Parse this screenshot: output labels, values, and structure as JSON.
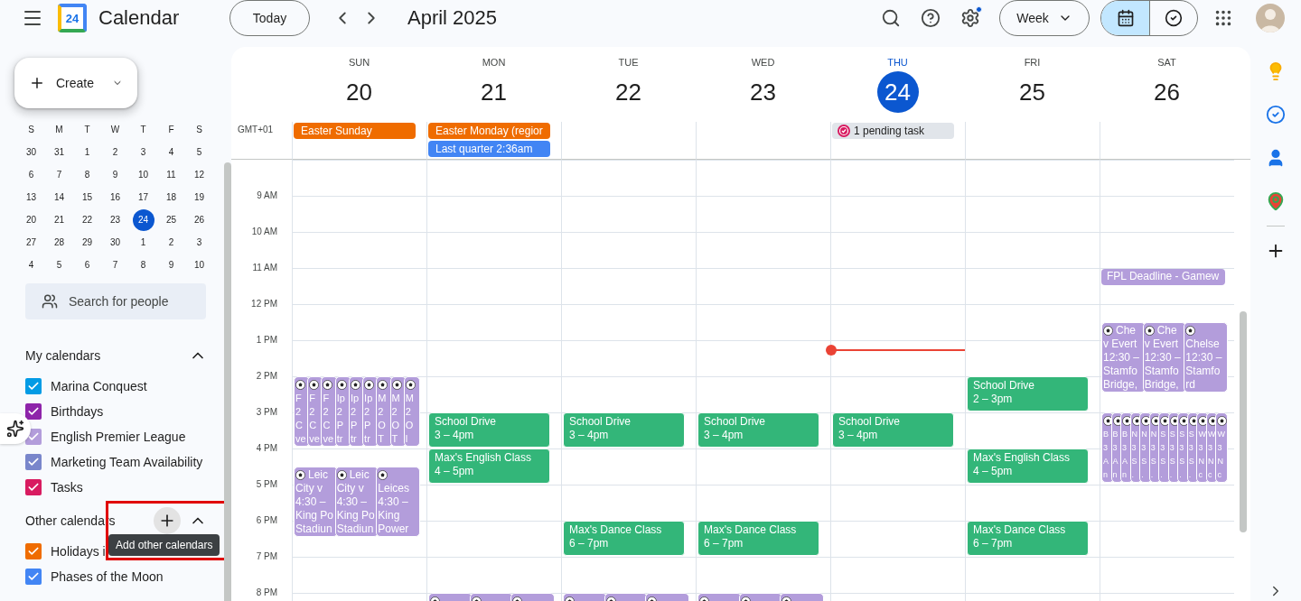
{
  "app": {
    "logo_text": "24",
    "name": "Calendar"
  },
  "toolbar": {
    "today": "Today",
    "title": "April 2025",
    "settings_badge": true,
    "view": "Week",
    "view_toggle": [
      {
        "kind": "calendar",
        "selected": true
      },
      {
        "kind": "tasks",
        "selected": false
      }
    ]
  },
  "sidebar": {
    "create": "Create",
    "mini_calendar": {
      "weekdays": [
        "S",
        "M",
        "T",
        "W",
        "T",
        "F",
        "S"
      ],
      "weeks": [
        [
          {
            "label": "30",
            "selected": false
          },
          {
            "label": "31",
            "selected": false
          },
          {
            "label": "1",
            "selected": false
          },
          {
            "label": "2",
            "selected": false
          },
          {
            "label": "3",
            "selected": false
          },
          {
            "label": "4",
            "selected": false
          },
          {
            "label": "5",
            "selected": false
          }
        ],
        [
          {
            "label": "6",
            "selected": false
          },
          {
            "label": "7",
            "selected": false
          },
          {
            "label": "8",
            "selected": false
          },
          {
            "label": "9",
            "selected": false
          },
          {
            "label": "10",
            "selected": false
          },
          {
            "label": "11",
            "selected": false
          },
          {
            "label": "12",
            "selected": false
          }
        ],
        [
          {
            "label": "13",
            "selected": false
          },
          {
            "label": "14",
            "selected": false
          },
          {
            "label": "15",
            "selected": false
          },
          {
            "label": "16",
            "selected": false
          },
          {
            "label": "17",
            "selected": false
          },
          {
            "label": "18",
            "selected": false
          },
          {
            "label": "19",
            "selected": false
          }
        ],
        [
          {
            "label": "20",
            "selected": false
          },
          {
            "label": "21",
            "selected": false
          },
          {
            "label": "22",
            "selected": false
          },
          {
            "label": "23",
            "selected": false
          },
          {
            "label": "24",
            "selected": true
          },
          {
            "label": "25",
            "selected": false
          },
          {
            "label": "26",
            "selected": false
          }
        ],
        [
          {
            "label": "27",
            "selected": false
          },
          {
            "label": "28",
            "selected": false
          },
          {
            "label": "29",
            "selected": false
          },
          {
            "label": "30",
            "selected": false
          },
          {
            "label": "1",
            "selected": false
          },
          {
            "label": "2",
            "selected": false
          },
          {
            "label": "3",
            "selected": false
          }
        ],
        [
          {
            "label": "4",
            "selected": false
          },
          {
            "label": "5",
            "selected": false
          },
          {
            "label": "6",
            "selected": false
          },
          {
            "label": "7",
            "selected": false
          },
          {
            "label": "8",
            "selected": false
          },
          {
            "label": "9",
            "selected": false
          },
          {
            "label": "10",
            "selected": false
          }
        ]
      ]
    },
    "search_people": "Search for people",
    "my_calendars": {
      "title": "My calendars",
      "expanded": true,
      "items": [
        {
          "label": "Marina Conquest",
          "checked": true,
          "color": "#039be5"
        },
        {
          "label": "Birthdays",
          "checked": true,
          "color": "#8e24aa"
        },
        {
          "label": "English Premier League",
          "checked": true,
          "color": "#b39ddb"
        },
        {
          "label": "Marketing Team Availability",
          "checked": true,
          "color": "#7986cb"
        },
        {
          "label": "Tasks",
          "checked": true,
          "color": "#d81b60"
        }
      ]
    },
    "other_calendars": {
      "title": "Other calendars",
      "expanded": true,
      "add_tooltip": "Add other calendars",
      "items": [
        {
          "label": "Holidays i",
          "checked": true,
          "color": "#ef6c00"
        },
        {
          "label": "Phases of the Moon",
          "checked": true,
          "color": "#4285f4"
        }
      ]
    }
  },
  "week": {
    "timezone": "GMT+01",
    "hours": [
      "9 AM",
      "10 AM",
      "11 AM",
      "12 PM",
      "1 PM",
      "2 PM",
      "3 PM",
      "4 PM",
      "5 PM",
      "6 PM",
      "7 PM",
      "8 PM"
    ],
    "days": [
      {
        "weekday": "SUN",
        "date": "20",
        "selected": false,
        "all_day": [
          {
            "kind": "event",
            "title": "Easter Sunday",
            "color": "#ef6c00"
          }
        ],
        "events": [
          {
            "kind": "group",
            "color": "#b39ddb",
            "cards": [
              {
                "lines": [
                  "F",
                  "2",
                  "C",
                  "ve"
                ]
              },
              {
                "lines": [
                  "F",
                  "2",
                  "C",
                  "ve"
                ]
              },
              {
                "lines": [
                  "F",
                  "2",
                  "C",
                  "ve"
                ]
              },
              {
                "lines": [
                  "Ip",
                  "2",
                  "P",
                  "tr"
                ]
              },
              {
                "lines": [
                  "Ip",
                  "2",
                  "P",
                  "tr"
                ]
              },
              {
                "lines": [
                  "Ip",
                  "2",
                  "P",
                  "tr"
                ]
              },
              {
                "lines": [
                  "M",
                  "2",
                  "O",
                  "T"
                ]
              },
              {
                "lines": [
                  "M",
                  "2",
                  "O",
                  "T"
                ]
              },
              {
                "lines": [
                  "M",
                  "2",
                  "O",
                  "l"
                ]
              }
            ]
          },
          {
            "kind": "group",
            "color": "#b39ddb",
            "cards": [
              {
                "title": "Leic",
                "lines": [
                  "City v",
                  "4:30 –",
                  "King Po",
                  "Stadiun"
                ]
              },
              {
                "title": "Leic",
                "lines": [
                  "City v",
                  "4:30 –",
                  "King Po",
                  "Stadiun"
                ]
              },
              {
                "lines": [
                  "Leices",
                  "4:30 –",
                  "King",
                  "Power"
                ]
              }
            ]
          }
        ]
      },
      {
        "weekday": "MON",
        "date": "21",
        "selected": false,
        "all_day": [
          {
            "kind": "event",
            "title": "Easter Monday (regior",
            "color": "#ef6c00"
          },
          {
            "kind": "event",
            "title": "Last quarter 2:36am",
            "color": "#4285f4"
          }
        ],
        "events": [
          {
            "kind": "event",
            "title": "School Drive",
            "time": "3 – 4pm",
            "color": "#33b679"
          },
          {
            "kind": "event",
            "title": "Max's English Class",
            "time": "4 – 5pm",
            "color": "#33b679"
          },
          {
            "kind": "group",
            "color": "#b39ddb",
            "cards": [
              {
                "kind": "icon_only"
              },
              {
                "kind": "icon_only"
              },
              {
                "kind": "icon_only"
              }
            ]
          }
        ]
      },
      {
        "weekday": "TUE",
        "date": "22",
        "selected": false,
        "events": [
          {
            "kind": "event",
            "title": "School Drive",
            "time": "3 – 4pm",
            "color": "#33b679"
          },
          {
            "kind": "event",
            "title": "Max's Dance Class",
            "time": "6 – 7pm",
            "color": "#33b679"
          },
          {
            "kind": "group",
            "color": "#b39ddb",
            "cards": [
              {
                "kind": "icon_only"
              },
              {
                "kind": "icon_only"
              },
              {
                "kind": "icon_only"
              }
            ]
          }
        ]
      },
      {
        "weekday": "WED",
        "date": "23",
        "selected": false,
        "events": [
          {
            "kind": "event",
            "title": "School Drive",
            "time": "3 – 4pm",
            "color": "#33b679"
          },
          {
            "kind": "event",
            "title": "Max's Dance Class",
            "time": "6 – 7pm",
            "color": "#33b679"
          },
          {
            "kind": "group",
            "color": "#b39ddb",
            "cards": [
              {
                "kind": "icon_only"
              },
              {
                "kind": "icon_only"
              },
              {
                "kind": "icon_only"
              }
            ]
          }
        ]
      },
      {
        "weekday": "THU",
        "date": "24",
        "selected": true,
        "now": true,
        "all_day": [
          {
            "kind": "task",
            "title": "1 pending task"
          }
        ],
        "events": [
          {
            "kind": "event",
            "title": "School Drive",
            "time": "3 – 4pm",
            "color": "#33b679"
          }
        ]
      },
      {
        "weekday": "FRI",
        "date": "25",
        "selected": false,
        "events": [
          {
            "kind": "event",
            "title": "School Drive",
            "time": "2 – 3pm",
            "color": "#33b679"
          },
          {
            "kind": "event",
            "title": "Max's English Class",
            "time": "4 – 5pm",
            "color": "#33b679"
          },
          {
            "kind": "event",
            "title": "Max's Dance Class",
            "time": "6 – 7pm",
            "color": "#33b679"
          }
        ]
      },
      {
        "weekday": "SAT",
        "date": "26",
        "selected": false,
        "events": [
          {
            "kind": "chip",
            "title": "FPL Deadline - Gamew",
            "color": "#b39ddb"
          },
          {
            "kind": "group",
            "color": "#b39ddb",
            "cards": [
              {
                "title": "Che",
                "lines": [
                  "v Evert",
                  "12:30 –",
                  "Stamfo",
                  "Bridge,"
                ]
              },
              {
                "title": "Che",
                "lines": [
                  "v Evert",
                  "12:30 –",
                  "Stamfo",
                  "Bridge,"
                ]
              },
              {
                "lines": [
                  "Chelse",
                  "12:30 –",
                  "Stamfo",
                  "rd"
                ]
              }
            ]
          },
          {
            "kind": "group",
            "color": "#b39ddb",
            "cards": [
              {
                "lines": [
                  "B",
                  "3",
                  "A",
                  "n"
                ]
              },
              {
                "lines": [
                  "B",
                  "3",
                  "A",
                  "n"
                ]
              },
              {
                "lines": [
                  "B",
                  "3",
                  "A",
                  "n"
                ]
              },
              {
                "lines": [
                  "N",
                  "3",
                  "S",
                  "."
                ]
              },
              {
                "lines": [
                  "N",
                  "3",
                  "S",
                  "."
                ]
              },
              {
                "lines": [
                  "N",
                  "3",
                  "S",
                  "."
                ]
              },
              {
                "lines": [
                  "S",
                  "3",
                  "S",
                  "."
                ]
              },
              {
                "lines": [
                  "S",
                  "3",
                  "S",
                  "."
                ]
              },
              {
                "lines": [
                  "S",
                  "3",
                  "S",
                  "."
                ]
              },
              {
                "lines": [
                  "S",
                  "3",
                  "S",
                  "."
                ]
              },
              {
                "lines": [
                  "W",
                  "3",
                  "N",
                  "c"
                ]
              },
              {
                "lines": [
                  "W",
                  "3",
                  "N",
                  "c"
                ]
              },
              {
                "lines": [
                  "W",
                  "3",
                  "N",
                  "c"
                ]
              }
            ]
          }
        ]
      }
    ]
  }
}
